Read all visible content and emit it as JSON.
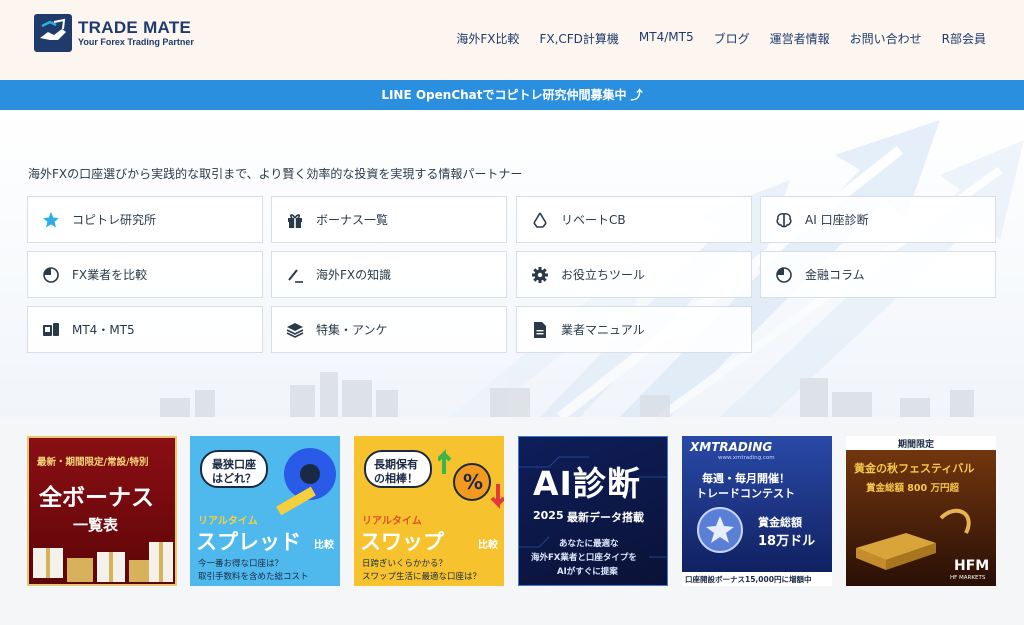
{
  "header": {
    "logo_name": "TRADE MATE",
    "logo_tagline": "Your Forex Trading Partner",
    "nav": [
      "海外FX比較",
      "FX,CFD計算機",
      "MT4/MT5",
      "ブログ",
      "運営者情報",
      "お問い合わせ",
      "R部会員"
    ]
  },
  "banner": {
    "text": "LINE OpenChatでコピトレ研究仲間募集中 ⤴"
  },
  "hero": {
    "description": "海外FXの口座選びから実践的な取引まで、より賢く効率的な投資を実現する情報パートナー",
    "cards": [
      {
        "label": "コピトレ研究所",
        "icon": "star-icon"
      },
      {
        "label": "ボーナス一覧",
        "icon": "gift-icon"
      },
      {
        "label": "リベートCB",
        "icon": "recycle-icon"
      },
      {
        "label": "AI 口座診断",
        "icon": "brain-icon"
      },
      {
        "label": "FX業者を比較",
        "icon": "pie-chart-icon"
      },
      {
        "label": "海外FXの知識",
        "icon": "pen-icon"
      },
      {
        "label": "お役立ちツール",
        "icon": "gear-icon"
      },
      {
        "label": "金融コラム",
        "icon": "pie-chart-icon"
      },
      {
        "label": "MT4・MT5",
        "icon": "devices-icon"
      },
      {
        "label": "特集・アンケ",
        "icon": "layers-icon"
      },
      {
        "label": "業者マニュアル",
        "icon": "document-icon"
      }
    ]
  },
  "promos": {
    "bonus": {
      "top": "最新・期間限定/常設/特別",
      "main": "全ボーナス",
      "sub": "一覧表"
    },
    "spread": {
      "bubble1": "最狭口座",
      "bubble2": "はどれ？",
      "tag": "リアルタイム",
      "main": "スプレッド",
      "compare": "比較",
      "note1": "今一番お得な口座は？",
      "note2": "取引手数料を含めた総コスト"
    },
    "swap": {
      "bubble1": "長期保有",
      "bubble2": "の相棒！",
      "tag": "リアルタイム",
      "main": "スワップ",
      "compare": "比較",
      "note1": "日跨ぎいくらかかる？",
      "note2": "スワップ生活に最適な口座は？"
    },
    "ai": {
      "main": "AI診断",
      "year": "2025",
      "yearsub": "最新データ搭載",
      "line1": "あなたに最適な",
      "line2": "海外FX業者と口座タイプを",
      "line3": "AIがすぐに提案"
    },
    "xm": {
      "brand": "XMTRADING",
      "site": "www.xmtrading.com",
      "line1": "毎週・毎月開催！",
      "line2": "トレードコンテスト",
      "prize1": "賞金総額",
      "prize2": "18万ドル",
      "footer": "口座開設ボーナス15,000円に増額中"
    },
    "hfm": {
      "tag": "期間限定",
      "title": "黄金の秋フェスティバル",
      "prize": "賞金総額 800 万円超",
      "brand": "HFM",
      "brandsub": "HF MARKETS"
    }
  },
  "colors": {
    "navy": "#1e3b6b",
    "banner": "#2b8fe0",
    "accent": "#2bb0e6"
  }
}
